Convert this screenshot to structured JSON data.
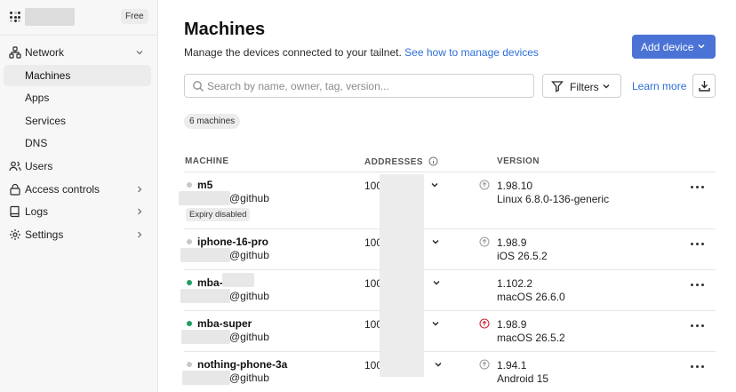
{
  "sidebar": {
    "plan_badge": "Free",
    "items": [
      {
        "label": "Network",
        "icon": "network-icon",
        "expanded": true
      },
      {
        "label": "Machines",
        "active": true
      },
      {
        "label": "Apps"
      },
      {
        "label": "Services"
      },
      {
        "label": "DNS"
      },
      {
        "label": "Users",
        "icon": "users-icon"
      },
      {
        "label": "Access controls",
        "icon": "lock-icon"
      },
      {
        "label": "Logs",
        "icon": "book-icon"
      },
      {
        "label": "Settings",
        "icon": "gear-icon"
      }
    ]
  },
  "main": {
    "title": "Machines",
    "subtitle": "Manage the devices connected to your tailnet.",
    "subtitle_link": "See how to manage devices",
    "add_device_label": "Add device",
    "search_placeholder": "Search by name, owner, tag, version...",
    "filters_label": "Filters",
    "learn_more_label": "Learn more",
    "machine_count": "6 machines"
  },
  "table": {
    "columns": [
      "MACHINE",
      "ADDRESSES",
      "VERSION"
    ],
    "rows": [
      {
        "name": "m5",
        "owner": "@github",
        "status": "offline",
        "badge": "Expiry disabled",
        "address": "100",
        "version": "1.98.10",
        "os": "Linux 6.8.0-136-generic",
        "update": "available"
      },
      {
        "name": "iphone-16-pro",
        "owner": "@github",
        "status": "offline",
        "address": "100",
        "version": "1.98.9",
        "os": "iOS 26.5.2",
        "update": "available"
      },
      {
        "name": "mba-",
        "owner": "@github",
        "status": "online",
        "address": "100",
        "version": "1.102.2",
        "os": "macOS 26.6.0",
        "update": "none"
      },
      {
        "name": "mba-super",
        "owner": "@github",
        "status": "online",
        "address": "100",
        "version": "1.98.9",
        "os": "macOS 26.5.2",
        "update": "security"
      },
      {
        "name": "nothing-phone-3a",
        "owner": "@github",
        "status": "offline",
        "address": "100",
        "version": "1.94.1",
        "os": "Android 15",
        "update": "available"
      }
    ]
  },
  "colors": {
    "accent": "#4b73d6",
    "link": "#2c6fd6",
    "online": "#1f9e63",
    "offline": "#c8c8c8",
    "security_update": "#c8283a"
  }
}
